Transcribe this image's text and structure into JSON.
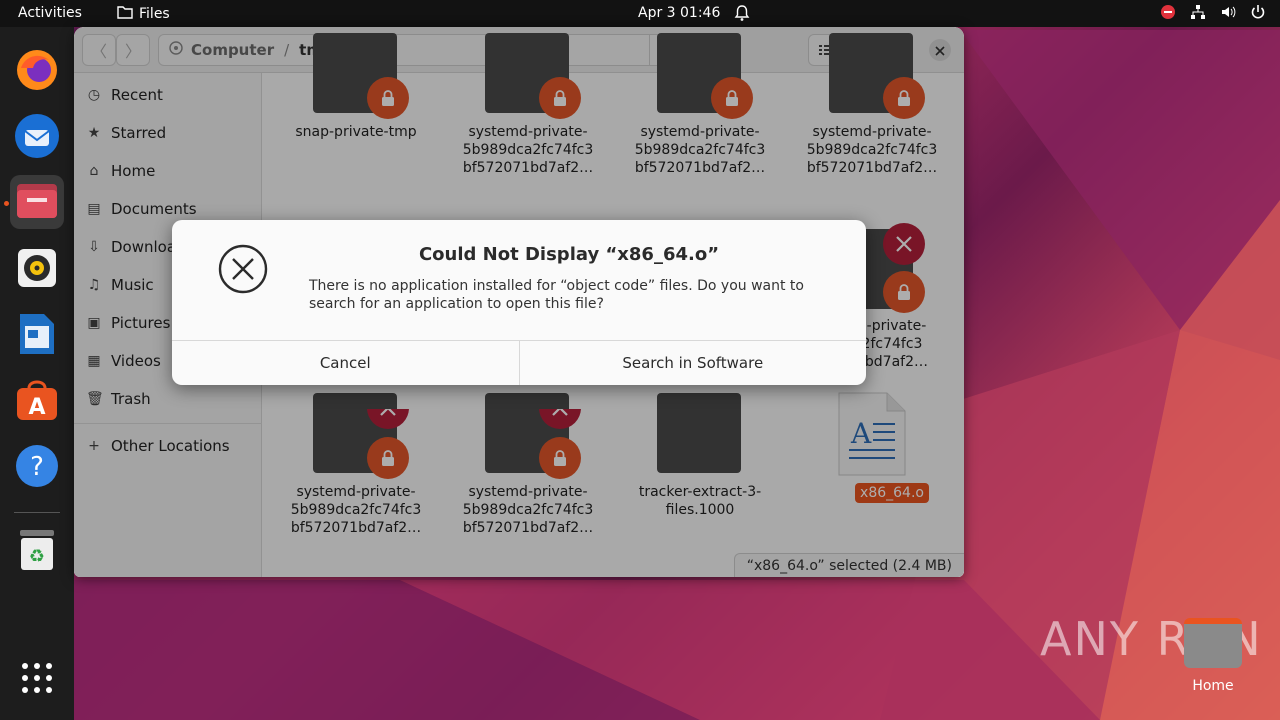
{
  "topbar": {
    "activities": "Activities",
    "app_name": "Files",
    "clock": "Apr 3  01:46"
  },
  "window": {
    "path": [
      "Computer",
      "tmp"
    ],
    "sidebar": [
      {
        "label": "Recent",
        "icon": "clock-icon"
      },
      {
        "label": "Starred",
        "icon": "star-icon"
      },
      {
        "label": "Home",
        "icon": "home-icon"
      },
      {
        "label": "Documents",
        "icon": "document-icon"
      },
      {
        "label": "Downloads",
        "icon": "download-icon"
      },
      {
        "label": "Music",
        "icon": "music-icon"
      },
      {
        "label": "Pictures",
        "icon": "picture-icon"
      },
      {
        "label": "Videos",
        "icon": "video-icon"
      },
      {
        "label": "Trash",
        "icon": "trash-icon"
      },
      {
        "label": "Other Locations",
        "icon": "plus-icon"
      }
    ],
    "files": [
      {
        "l1": "snap-private-tmp",
        "l2": "",
        "l3": ""
      },
      {
        "l1": "systemd-private-",
        "l2": "5b989dca2fc74fc3",
        "l3": "bf572071bd7af2…"
      },
      {
        "l1": "systemd-private-",
        "l2": "5b989dca2fc74fc3",
        "l3": "bf572071bd7af2…"
      },
      {
        "l1": "systemd-private-",
        "l2": "5b989dca2fc74fc3",
        "l3": "bf572071bd7af2…"
      },
      {
        "l1": "d-private-",
        "l2": "2fc74fc3",
        "l3": "1bd7af2…"
      },
      {
        "l1": "systemd-private-",
        "l2": "5b989dca2fc74fc3",
        "l3": "bf572071bd7af2…"
      },
      {
        "l1": "systemd-private-",
        "l2": "5b989dca2fc74fc3",
        "l3": "bf572071bd7af2…"
      },
      {
        "l1": "tracker-extract-3-",
        "l2": "files.1000",
        "l3": ""
      },
      {
        "l1": "x86_64.o",
        "l2": "",
        "l3": ""
      }
    ],
    "status": "“x86_64.o” selected (2.4 MB)"
  },
  "dialog": {
    "title": "Could Not Display “x86_64.o”",
    "message": "There is no application installed for “object code” files. Do you want to search for an application to open this file?",
    "cancel": "Cancel",
    "search": "Search in Software"
  },
  "desktop": {
    "home_label": "Home",
    "watermark": "ANY RUN"
  },
  "colors": {
    "accent": "#e95420",
    "lock_badge": "#e2562a",
    "error_badge": "#b3203a"
  }
}
